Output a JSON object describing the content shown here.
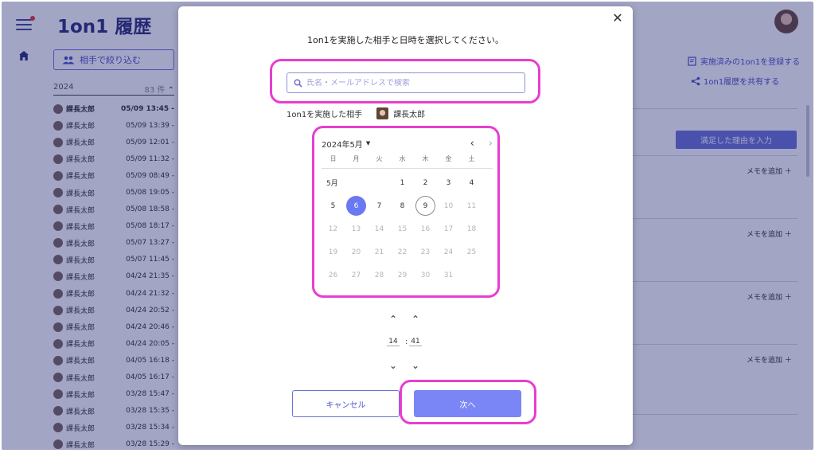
{
  "app": {
    "title": "1on1 履歴",
    "filter_label": "相手で絞り込む",
    "year": "2024",
    "year_count": "83 件",
    "history": [
      {
        "name": "課長太郎",
        "date": "05/09 13:45 -",
        "active": true
      },
      {
        "name": "課長太郎",
        "date": "05/09 13:39 -"
      },
      {
        "name": "課長太郎",
        "date": "05/09 12:01 -"
      },
      {
        "name": "課長太郎",
        "date": "05/09 11:32 -"
      },
      {
        "name": "課長太郎",
        "date": "05/09 08:49 -"
      },
      {
        "name": "課長太郎",
        "date": "05/08 19:05 -"
      },
      {
        "name": "課長太郎",
        "date": "05/08 18:58 -"
      },
      {
        "name": "課長太郎",
        "date": "05/08 18:17 -"
      },
      {
        "name": "課長太郎",
        "date": "05/07 13:27 -"
      },
      {
        "name": "課長太郎",
        "date": "05/07 11:45 -"
      },
      {
        "name": "課長太郎",
        "date": "04/24 21:35 -"
      },
      {
        "name": "課長太郎",
        "date": "04/24 21:32 -"
      },
      {
        "name": "課長太郎",
        "date": "04/24 20:52 -"
      },
      {
        "name": "課長太郎",
        "date": "04/24 20:46 -"
      },
      {
        "name": "課長太郎",
        "date": "04/24 20:05 -"
      },
      {
        "name": "課長太郎",
        "date": "04/05 16:18 -"
      },
      {
        "name": "課長太郎",
        "date": "04/05 16:17 -"
      },
      {
        "name": "課長太郎",
        "date": "03/28 15:47 -"
      },
      {
        "name": "課長太郎",
        "date": "03/28 15:35 -"
      },
      {
        "name": "課長太郎",
        "date": "03/28 15:34 -"
      },
      {
        "name": "課長太郎",
        "date": "03/28 15:29 -"
      }
    ],
    "register_link": "実施済みの1on1を登録する",
    "share_link": "1on1履歴を共有する",
    "satisfy_button": "満足した理由を入力",
    "memo_label": "メモを追加"
  },
  "modal": {
    "title": "1on1を実施した相手と日時を選択してください。",
    "search_placeholder": "氏名・メールアドレスで検索",
    "partner_label": "1on1を実施した相手",
    "partner_name": "課長太郎",
    "calendar": {
      "month_label": "2024年5月",
      "weekdays": [
        "日",
        "月",
        "火",
        "水",
        "木",
        "金",
        "土"
      ],
      "month_short": "5月",
      "selected_day": 6,
      "today": 9,
      "weeks": [
        [
          null,
          null,
          null,
          1,
          2,
          3,
          4
        ],
        [
          5,
          6,
          7,
          8,
          9,
          10,
          11
        ],
        [
          12,
          13,
          14,
          15,
          16,
          17,
          18
        ],
        [
          19,
          20,
          21,
          22,
          23,
          24,
          25
        ],
        [
          26,
          27,
          28,
          29,
          30,
          31,
          null
        ]
      ],
      "enabled_through": 9
    },
    "time": {
      "hour": "14",
      "minute": "41"
    },
    "cancel_label": "キャンセル",
    "next_label": "次へ"
  },
  "colors": {
    "accent": "#6c73d8",
    "highlight": "#e83ecf",
    "selected_day": "#6a78f2"
  }
}
